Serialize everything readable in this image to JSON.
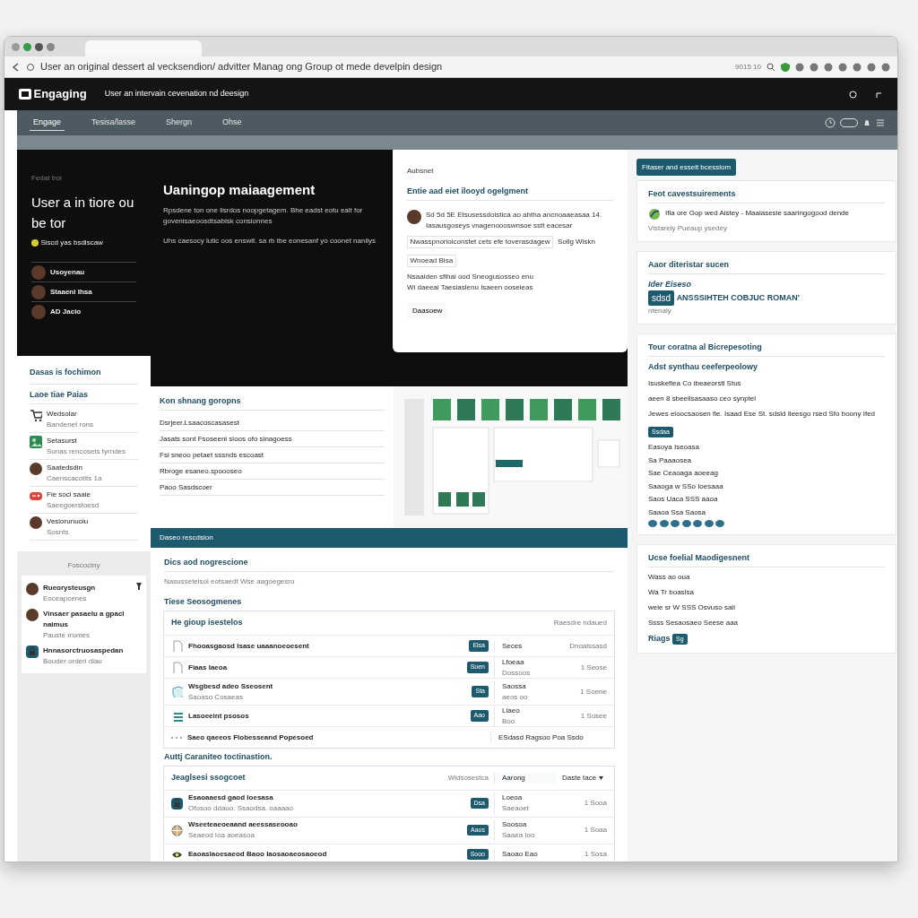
{
  "browser": {
    "url": "User an original dessert al vecksendion/ advitter Manag ong Group ot mede develpin design",
    "zoom": "9015 10"
  },
  "site": {
    "logo": "Engaging",
    "title": "User an intervain cevenation nd deesign"
  },
  "nav": [
    {
      "label": "Engage",
      "selected": true
    },
    {
      "label": "Tesisa/lasse",
      "selected": false
    },
    {
      "label": "Shergn",
      "selected": false
    },
    {
      "label": "Ohse",
      "selected": false
    }
  ],
  "left_hero": {
    "eyebrow": "Fedat trol",
    "title": "User a in tiore ou be tor",
    "status": "Siscd yas bsdiscaw",
    "people": [
      {
        "name": "Usoyenau"
      },
      {
        "name": "Staaeni Ihsa"
      },
      {
        "name": "AD Jacio"
      }
    ]
  },
  "left_panel": {
    "title": "Dasas is fochimon",
    "subtitle": "Laoe tiae Paias",
    "items": [
      {
        "kind": "cart",
        "title": "Wedsolar",
        "sub": "Bandenet rons"
      },
      {
        "kind": "image",
        "title": "Setasurst",
        "sub": "Sunas rencosets tyrndes"
      },
      {
        "kind": "avatar",
        "title": "Saatedsdin",
        "sub": "Caenscacotits 1a"
      },
      {
        "kind": "game",
        "title": "Fie soci saaie",
        "sub": "Saeegoerstoesd"
      },
      {
        "kind": "avatar",
        "title": "Vesiorunuoiu",
        "sub": "Sosnts"
      }
    ]
  },
  "people_panel": {
    "label": "Foscociny",
    "people": [
      {
        "kind": "avatar",
        "name": "Rueorysteusgn",
        "sub": "Eoceapcenes",
        "pinned": true
      },
      {
        "kind": "avatar",
        "name": "Vinsaer pasaelu a gpacl naimus",
        "sub": "Pauste rrumes",
        "pinned": false
      },
      {
        "kind": "lock",
        "name": "Hnnasorctruosaspedan",
        "sub": "Bouder orderi diau",
        "pinned": false
      }
    ]
  },
  "hero": {
    "title": "Uaningop maiaagement",
    "paragraphs": [
      "Rpsdene ton one lisrdos noopgetagem. Bhe eadst eotu ealt for govenisaeoosdtsabisk consionnes",
      "Uhs caesocy lutic oos enswit. sa rb tbe eonesanf yo coonet naniiys"
    ]
  },
  "overlay_card": {
    "label": "Aubsnet",
    "title": "Entie aad eiet ilooyd ogelgment",
    "comment": "Sd 5d 5E Etsusessdoistica ao ahtha ancnoaaeasaa 14. Iasausgoseys vnagenoooswnsoe sstt eacesar",
    "quote": "Nwasspnorioiconstet cets efe toverasdagew",
    "quote_after": "Sollg Wiskn",
    "tag": "Wnoead Bisa",
    "notes": [
      "Nsaaiden sfihai ood Sneogusosseo enu",
      "Wi daeeai Taesiaslenu Isaeen ooseieas"
    ],
    "button": "Daasoew"
  },
  "topics": {
    "title": "Kon shnang goropns",
    "items": [
      "Dsrjeer.Lsaacoscasasest",
      "Jasats sont Fsoseeni sioos ofo sinagoess",
      "Fsi sneoo petaet sssnds escoast",
      "Rbroge esaneo.spoooseo",
      "Paoo Sasdscoer"
    ]
  },
  "band": {
    "title": "Daseo rescdsion"
  },
  "main": {
    "title": "Dics aod nogrescione",
    "subtitle": "Nasusseteisol eotsaedt Wse aagoegesro",
    "sections": [
      {
        "title": "Tiese Seosogmenes",
        "head": {
          "title": "He gioup isestelos",
          "note": "Raesdre ndaued"
        },
        "rows": [
          {
            "kind": "document",
            "title": "Fhooasgaosd Isase uaaanoeoesent",
            "sub": "",
            "badge": "Elsa",
            "c1": "Seces",
            "c1sub": "",
            "c2": "Dnoalssasd"
          },
          {
            "kind": "document",
            "title": "Fiaas Iaeoa",
            "sub": "",
            "badge": "Soen",
            "c1": "Lfoeaa",
            "c1sub": "Dossoos",
            "c2": "1 Seose"
          },
          {
            "kind": "shield",
            "title": "Wsgbesd adeo Sseosent",
            "sub": "Saoaso Cosaeas",
            "badge": "Sta",
            "c1": "Saossa",
            "c1sub": "aeos oo",
            "c2": "1 Soene"
          },
          {
            "kind": "stack",
            "title": "Lasoeeint psosos",
            "sub": "",
            "badge": "Aao",
            "c1": "Liaeo",
            "c1sub": "Boo",
            "c2": "1 Sosee"
          },
          {
            "kind": "dots",
            "title": "Saeo qaeeos Flobesseand Popesoed",
            "sub": "",
            "badge": "",
            "c1": "ESdasd Ragsoo Poa Ssdo",
            "c1sub": "",
            "c2": ""
          }
        ]
      },
      {
        "title": "Auttj Caraniteo toctinastion.",
        "head": {
          "title": "Jeaglsesi ssogcoet",
          "note": "Widsosestca",
          "field": "Aarong",
          "menu": "Daste tace"
        },
        "rows": [
          {
            "kind": "lock",
            "title": "Esaoaaesd gaod Ioesasa",
            "sub": "Ofosoo ddauo. Ssaodsa. oaaaao",
            "badge": "Dsa",
            "c1": "Loeoa",
            "c1sub": "Saeaoet",
            "c2": "1 Sooa"
          },
          {
            "kind": "globe",
            "title": "Wseeteaeoeaand aeessaseooao",
            "sub": "Seaeod Ioa aoeasoa",
            "badge": "Aaos",
            "c1": "Soosoa",
            "c1sub": "Saaea Ioo",
            "c2": "1 Soaa"
          },
          {
            "kind": "eye",
            "title": "Eaoaslaoesaeod Baoo Iaosaoaeosaoeod",
            "sub": "",
            "badge": "Sooo",
            "c1": "Saoao Eao",
            "c1sub": "",
            "c2": "1 Sosa"
          }
        ]
      }
    ]
  },
  "right": {
    "button": "Fitaser and esseit bcessiom",
    "feature": {
      "title": "Feot cavestsuirements",
      "text": "Ifla ore Gop wed Aistey - Maalasesie saaringogood dende",
      "byline": "Vistarely Pueaup ysedey"
    },
    "card2": {
      "title": "Aaor diteristar sucen",
      "label": "Ider Eiseso",
      "badge": "sdsd",
      "headline": "ANSSSIHTEH COBJUC ROMAN'",
      "sub": "ntenaly"
    },
    "section": {
      "title": "Tour coratna al Bicrepesoting",
      "subtitle": "Adst synthau ceeferpeolowy",
      "lines": [
        "Isuskefiea Co ibeaeorstl Stus",
        "aeen 8 sbeelisasaaso ceo synptel",
        "Jewes eloocsaosen fie. Isaad Ese St. sdsld Ileesgo rsed Sfo boony Ifed"
      ],
      "chip": "Ssdaa",
      "items": [
        "Easoya Iseoasa",
        "Sa Paaaosea",
        "Sae Ceaoaga aoeeag",
        "Saaoga w SSo Ioesaaa",
        "Saos Uaca SSS aaoa",
        "Saaoa Ssa Saosa"
      ]
    },
    "card3": {
      "title": "Ucse foelial Maodigesnent",
      "lines": [
        "Wass ao oua",
        "Wa Tr boaslsa",
        "wele sr W SSS Osvuso sali",
        "Ssss Sesaosaeo Seese aaa"
      ],
      "footer": "Riags",
      "chip": "Sg"
    }
  }
}
